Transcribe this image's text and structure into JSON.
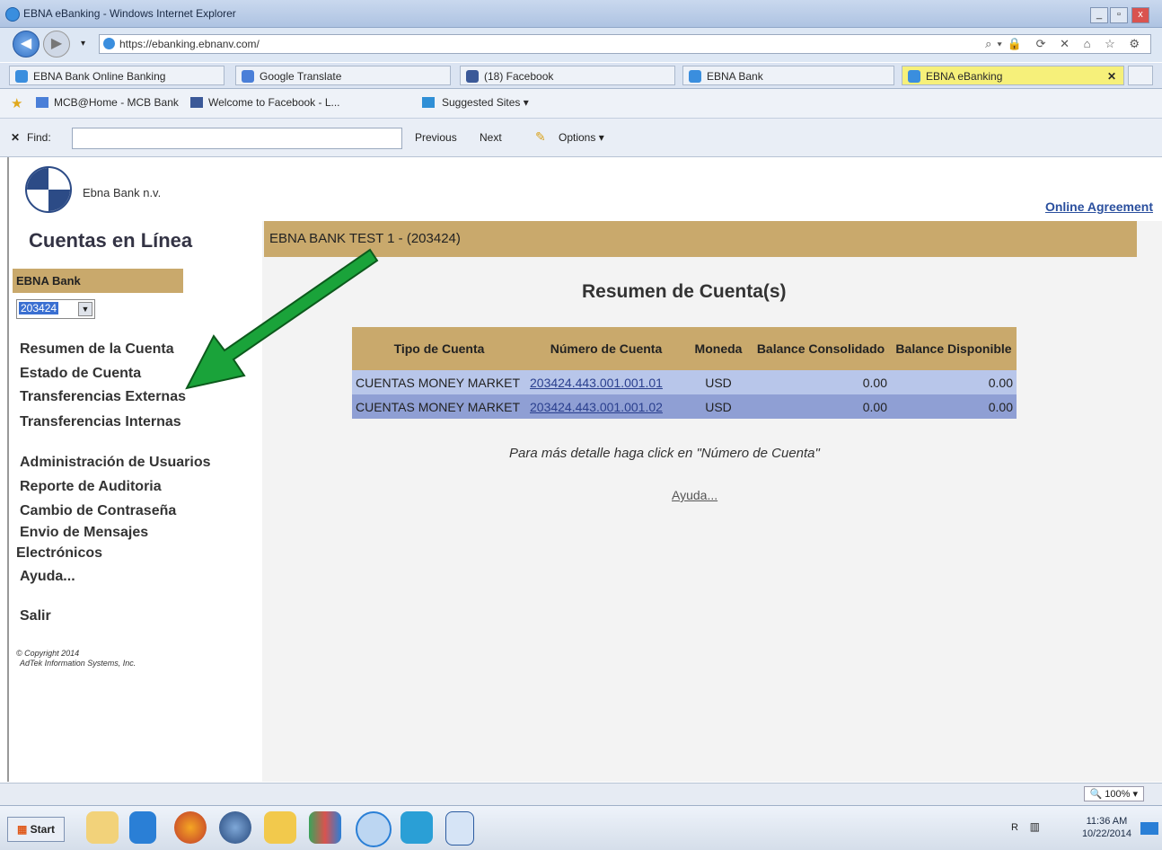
{
  "window": {
    "title": "EBNA eBanking - Windows Internet Explorer",
    "minimize": "_",
    "maximize": "▫",
    "close": "x"
  },
  "address": {
    "url": "https://ebanking.ebnanv.com/"
  },
  "tabs": [
    {
      "label": "EBNA Bank Online Banking",
      "color": "#3a8ede"
    },
    {
      "label": "Google Translate",
      "color": "#4a7fd8"
    },
    {
      "label": "(18) Facebook",
      "color": "#3b5998"
    },
    {
      "label": "EBNA Bank",
      "color": "#3a8ede"
    },
    {
      "label": "EBNA eBanking",
      "color": "#3a8ede",
      "active": true
    }
  ],
  "favorites": {
    "items": [
      "MCB@Home - MCB Bank",
      "Welcome to Facebook - L...",
      "Suggested Sites ▾"
    ]
  },
  "findbar": {
    "close": "✕",
    "label": "Find:",
    "previous": "Previous",
    "next": "Next",
    "options": "Options ▾"
  },
  "site": {
    "logo_text": "Ebna Bank n.v.",
    "agreement_link": "Online Agreement"
  },
  "sidebar": {
    "title": "Cuentas en Línea",
    "bank": "EBNA Bank",
    "account_selected": "203424",
    "menu": [
      "Resumen de la Cuenta",
      "Estado de Cuenta",
      "Transferencias Externas",
      "Transferencias Internas",
      "Administración de Usuarios",
      "Reporte de Auditoria",
      "Cambio de Contraseña",
      "Envio de Mensajes",
      "Electrónicos",
      "Ayuda...",
      "Salir"
    ],
    "copyright_1": "© Copyright 2014",
    "copyright_2": "AdTek Information Systems, Inc."
  },
  "content": {
    "header": "EBNA BANK TEST 1 - (203424)",
    "title": "Resumen de Cuenta(s)",
    "table": {
      "headers": [
        "Tipo de Cuenta",
        "Número de Cuenta",
        "Moneda",
        "Balance Consolidado",
        "Balance Disponible"
      ],
      "rows": [
        [
          "CUENTAS MONEY MARKET",
          "203424.443.001.001.01",
          "USD",
          "0.00",
          "0.00"
        ],
        [
          "CUENTAS MONEY MARKET",
          "203424.443.001.001.02",
          "USD",
          "0.00",
          "0.00"
        ]
      ]
    },
    "hint": "Para más detalle haga click en \"Número de Cuenta\"",
    "help": "Ayuda..."
  },
  "statusbar": {
    "zoom": "🔍 100%  ▾"
  },
  "taskbar": {
    "start": "Start",
    "time": "11:36 AM",
    "date": "10/22/2014"
  },
  "annotation_arrow_color": "#1aa33a"
}
